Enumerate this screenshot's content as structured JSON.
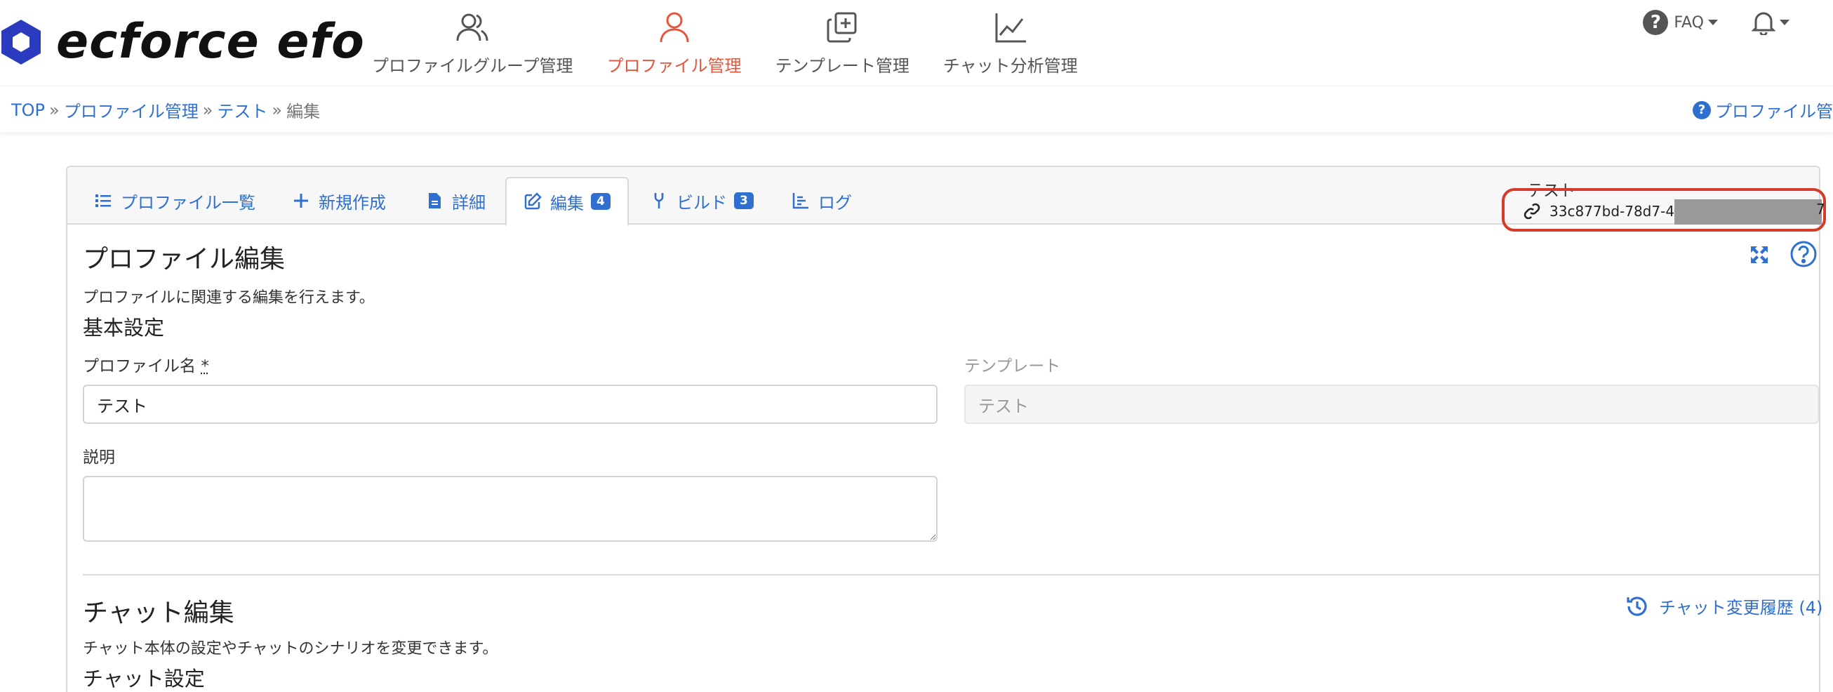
{
  "brand": {
    "name": "ecforce efo",
    "logo_color": "#2b3bbf"
  },
  "nav": {
    "items": [
      {
        "label": "プロファイルグループ管理",
        "icon": "users-icon",
        "active": false
      },
      {
        "label": "プロファイル管理",
        "icon": "user-icon",
        "active": true
      },
      {
        "label": "テンプレート管理",
        "icon": "copy-plus-icon",
        "active": false
      },
      {
        "label": "チャット分析管理",
        "icon": "line-chart-icon",
        "active": false
      }
    ],
    "faq_label": "FAQ",
    "active_color": "#e4573d"
  },
  "breadcrumb": {
    "items": [
      "TOP",
      "プロファイル管理",
      "テスト"
    ],
    "current": "編集",
    "separator": "»"
  },
  "help_link": "プロファイル管理",
  "tabs": [
    {
      "label": "プロファイル一覧",
      "icon": "list-icon"
    },
    {
      "label": "新規作成",
      "icon": "plus-icon"
    },
    {
      "label": "詳細",
      "icon": "file-icon"
    },
    {
      "label": "編集",
      "icon": "edit-icon",
      "badge": "4",
      "active": true
    },
    {
      "label": "ビルド",
      "icon": "wrench-icon",
      "badge": "3"
    },
    {
      "label": "ログ",
      "icon": "chart-icon"
    }
  ],
  "profile_corner": {
    "title": "テスト",
    "id_prefix": "33c877bd-78d7-43",
    "id_suffix": "7"
  },
  "profile_edit": {
    "title": "プロファイル編集",
    "description": "プロファイルに関連する編集を行えます。",
    "basic_settings": "基本設定",
    "name_label": "プロファイル名",
    "name_required": "*",
    "name_value": "テスト",
    "template_label": "テンプレート",
    "template_value": "テスト",
    "desc_label": "説明",
    "desc_value": ""
  },
  "chat_edit": {
    "title": "チャット編集",
    "description": "チャット本体の設定やチャットのシナリオを変更できます。",
    "history_link": "チャット変更履歴 (4)",
    "chat_settings": "チャット設定"
  },
  "colors": {
    "link": "#2f6fcf",
    "highlight_border": "#d43b2a"
  }
}
